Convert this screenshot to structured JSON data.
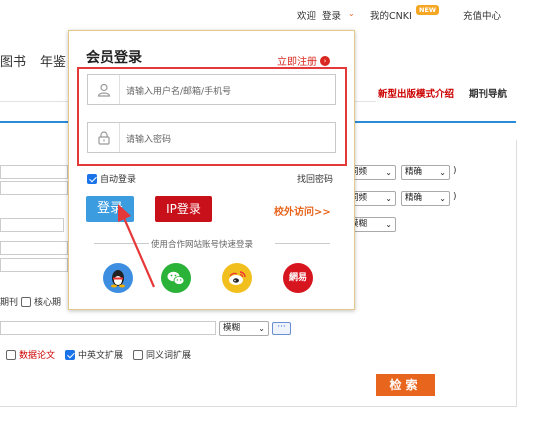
{
  "topbar": {
    "welcome": "欢迎",
    "login": "登录",
    "my_cnki": "我的CNKI",
    "new_badge": "NEW",
    "recharge": "充值中心"
  },
  "nav": {
    "tab_book": "图书",
    "tab_year": "年鉴",
    "link_new_mode": "新型出版模式介绍",
    "link_journal_nav": "期刊导航"
  },
  "form": {
    "rows": [
      {
        "freq": "词频",
        "match": "精确"
      },
      {
        "freq": "词频",
        "match": "精确"
      }
    ],
    "fuzzy_select": "模糊",
    "fuzzy_select_2": "模糊",
    "journal_label": "期刊",
    "core_label": "核心期",
    "data_paper": "数据论文",
    "cn_en_ext": "中英文扩展",
    "synonym_ext": "同义词扩展",
    "dots": "···",
    "search_btn": "检索",
    "accent": "#e8651e"
  },
  "dialog": {
    "title": "会员登录",
    "register": "立即注册",
    "username_placeholder": "请输入用户名/邮箱/手机号",
    "password_placeholder": "请输入密码",
    "auto_login": "自动登录",
    "forgot_password": "找回密码",
    "login_btn": "登录",
    "ip_login_btn": "IP登录",
    "offsite_access": "校外访问>>",
    "third_party": "使用合作网站账号快速登录",
    "netease": "網易",
    "highlight_color": "#e53939"
  }
}
